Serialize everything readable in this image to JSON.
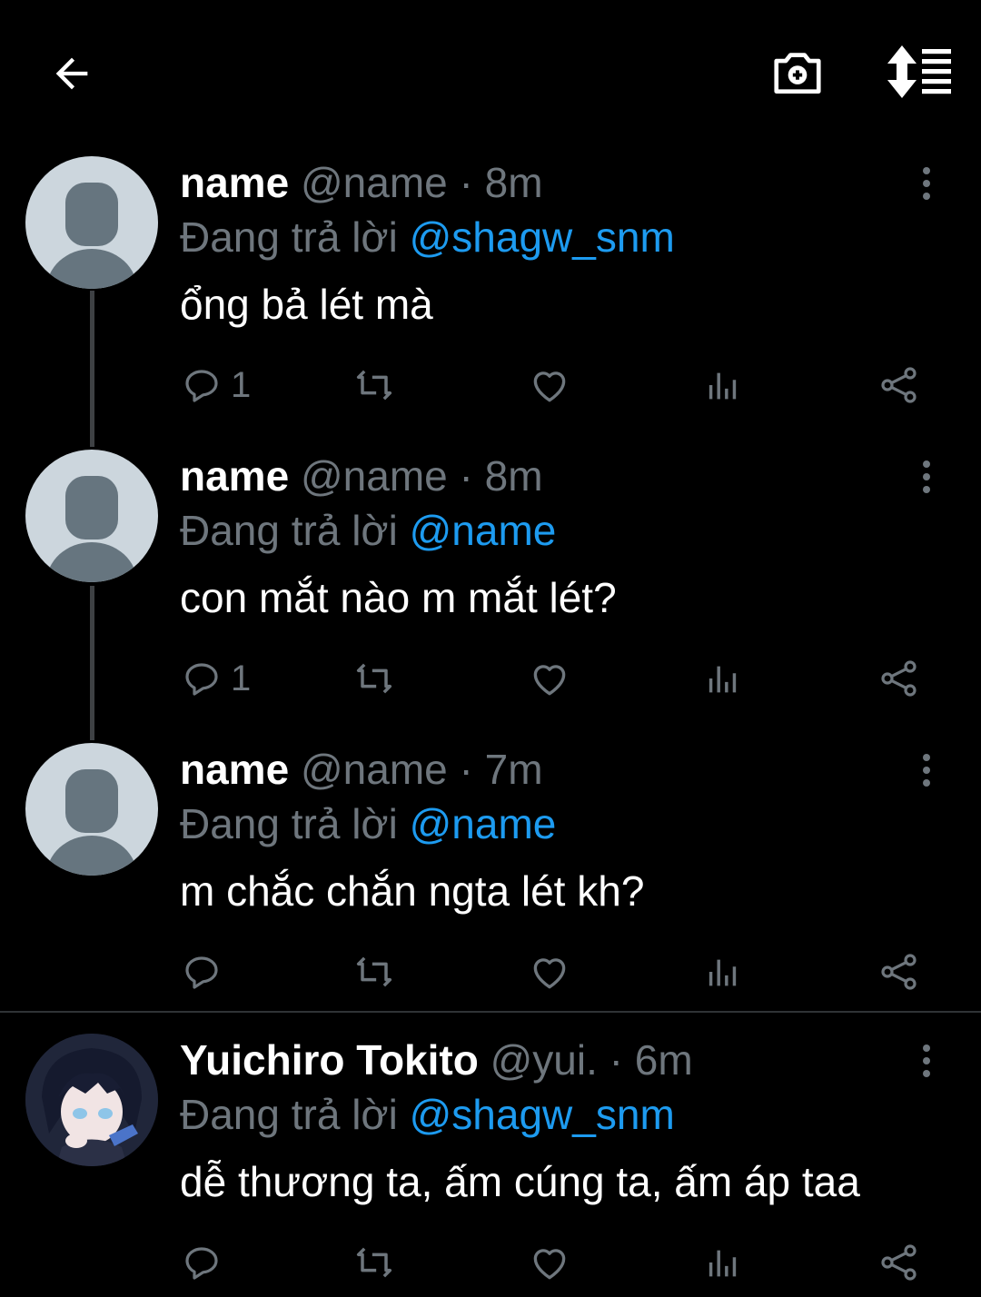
{
  "topbar": {
    "back_icon": "arrow-left-icon",
    "camera_icon": "camera-plus-icon",
    "sort_icon": "sort-list-icon"
  },
  "tweets": [
    {
      "name": "name",
      "handle": "@name",
      "dot": "·",
      "time": "8m",
      "reply_prefix": "Đang trả lời",
      "reply_to": "@shagw_snm",
      "text": "ổng bả lét mà",
      "reply_count": "1"
    },
    {
      "name": "name",
      "handle": "@name",
      "dot": "·",
      "time": "8m",
      "reply_prefix": "Đang trả lời",
      "reply_to": "@name",
      "text": "con mắt nào m mắt lét?",
      "reply_count": "1"
    },
    {
      "name": "name",
      "handle": "@name",
      "dot": "·",
      "time": "7m",
      "reply_prefix": "Đang trả lời",
      "reply_to": "@name",
      "text": "m chắc chắn ngta lét kh?",
      "reply_count": ""
    },
    {
      "name": "Yuichiro Tokito",
      "handle": "@yui.",
      "dot": "·",
      "time": "6m",
      "reply_prefix": "Đang trả lời",
      "reply_to": "@shagw_snm",
      "text": "dễ thương ta, ấm cúng ta, ấm áp taa",
      "reply_count": ""
    }
  ],
  "colors": {
    "background": "#000000",
    "mention": "#1d9bf0",
    "secondary_text": "#6e767d"
  }
}
